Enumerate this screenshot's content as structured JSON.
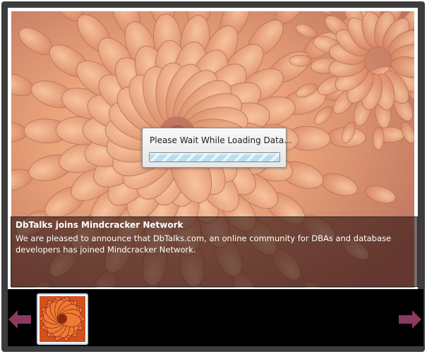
{
  "slide": {
    "title": "DbTalks joins Mindcracker Network",
    "description": "We are pleased to announce that DbTalks.com, an online community for DBAs and database developers has joined Mindcracker Network."
  },
  "loading": {
    "message": "Please Wait While Loading Data...",
    "progress": 1.0
  },
  "thumbnails": [
    {
      "name": "flower-thumbnail",
      "selected": true
    }
  ],
  "navigation": {
    "prev_icon": "arrow-left-icon",
    "next_icon": "arrow-right-icon",
    "arrow_color": "#8b3a5e"
  },
  "colors": {
    "frame": "#3c3c3c",
    "strip": "#000000",
    "flower_primary": "#d9642a"
  }
}
